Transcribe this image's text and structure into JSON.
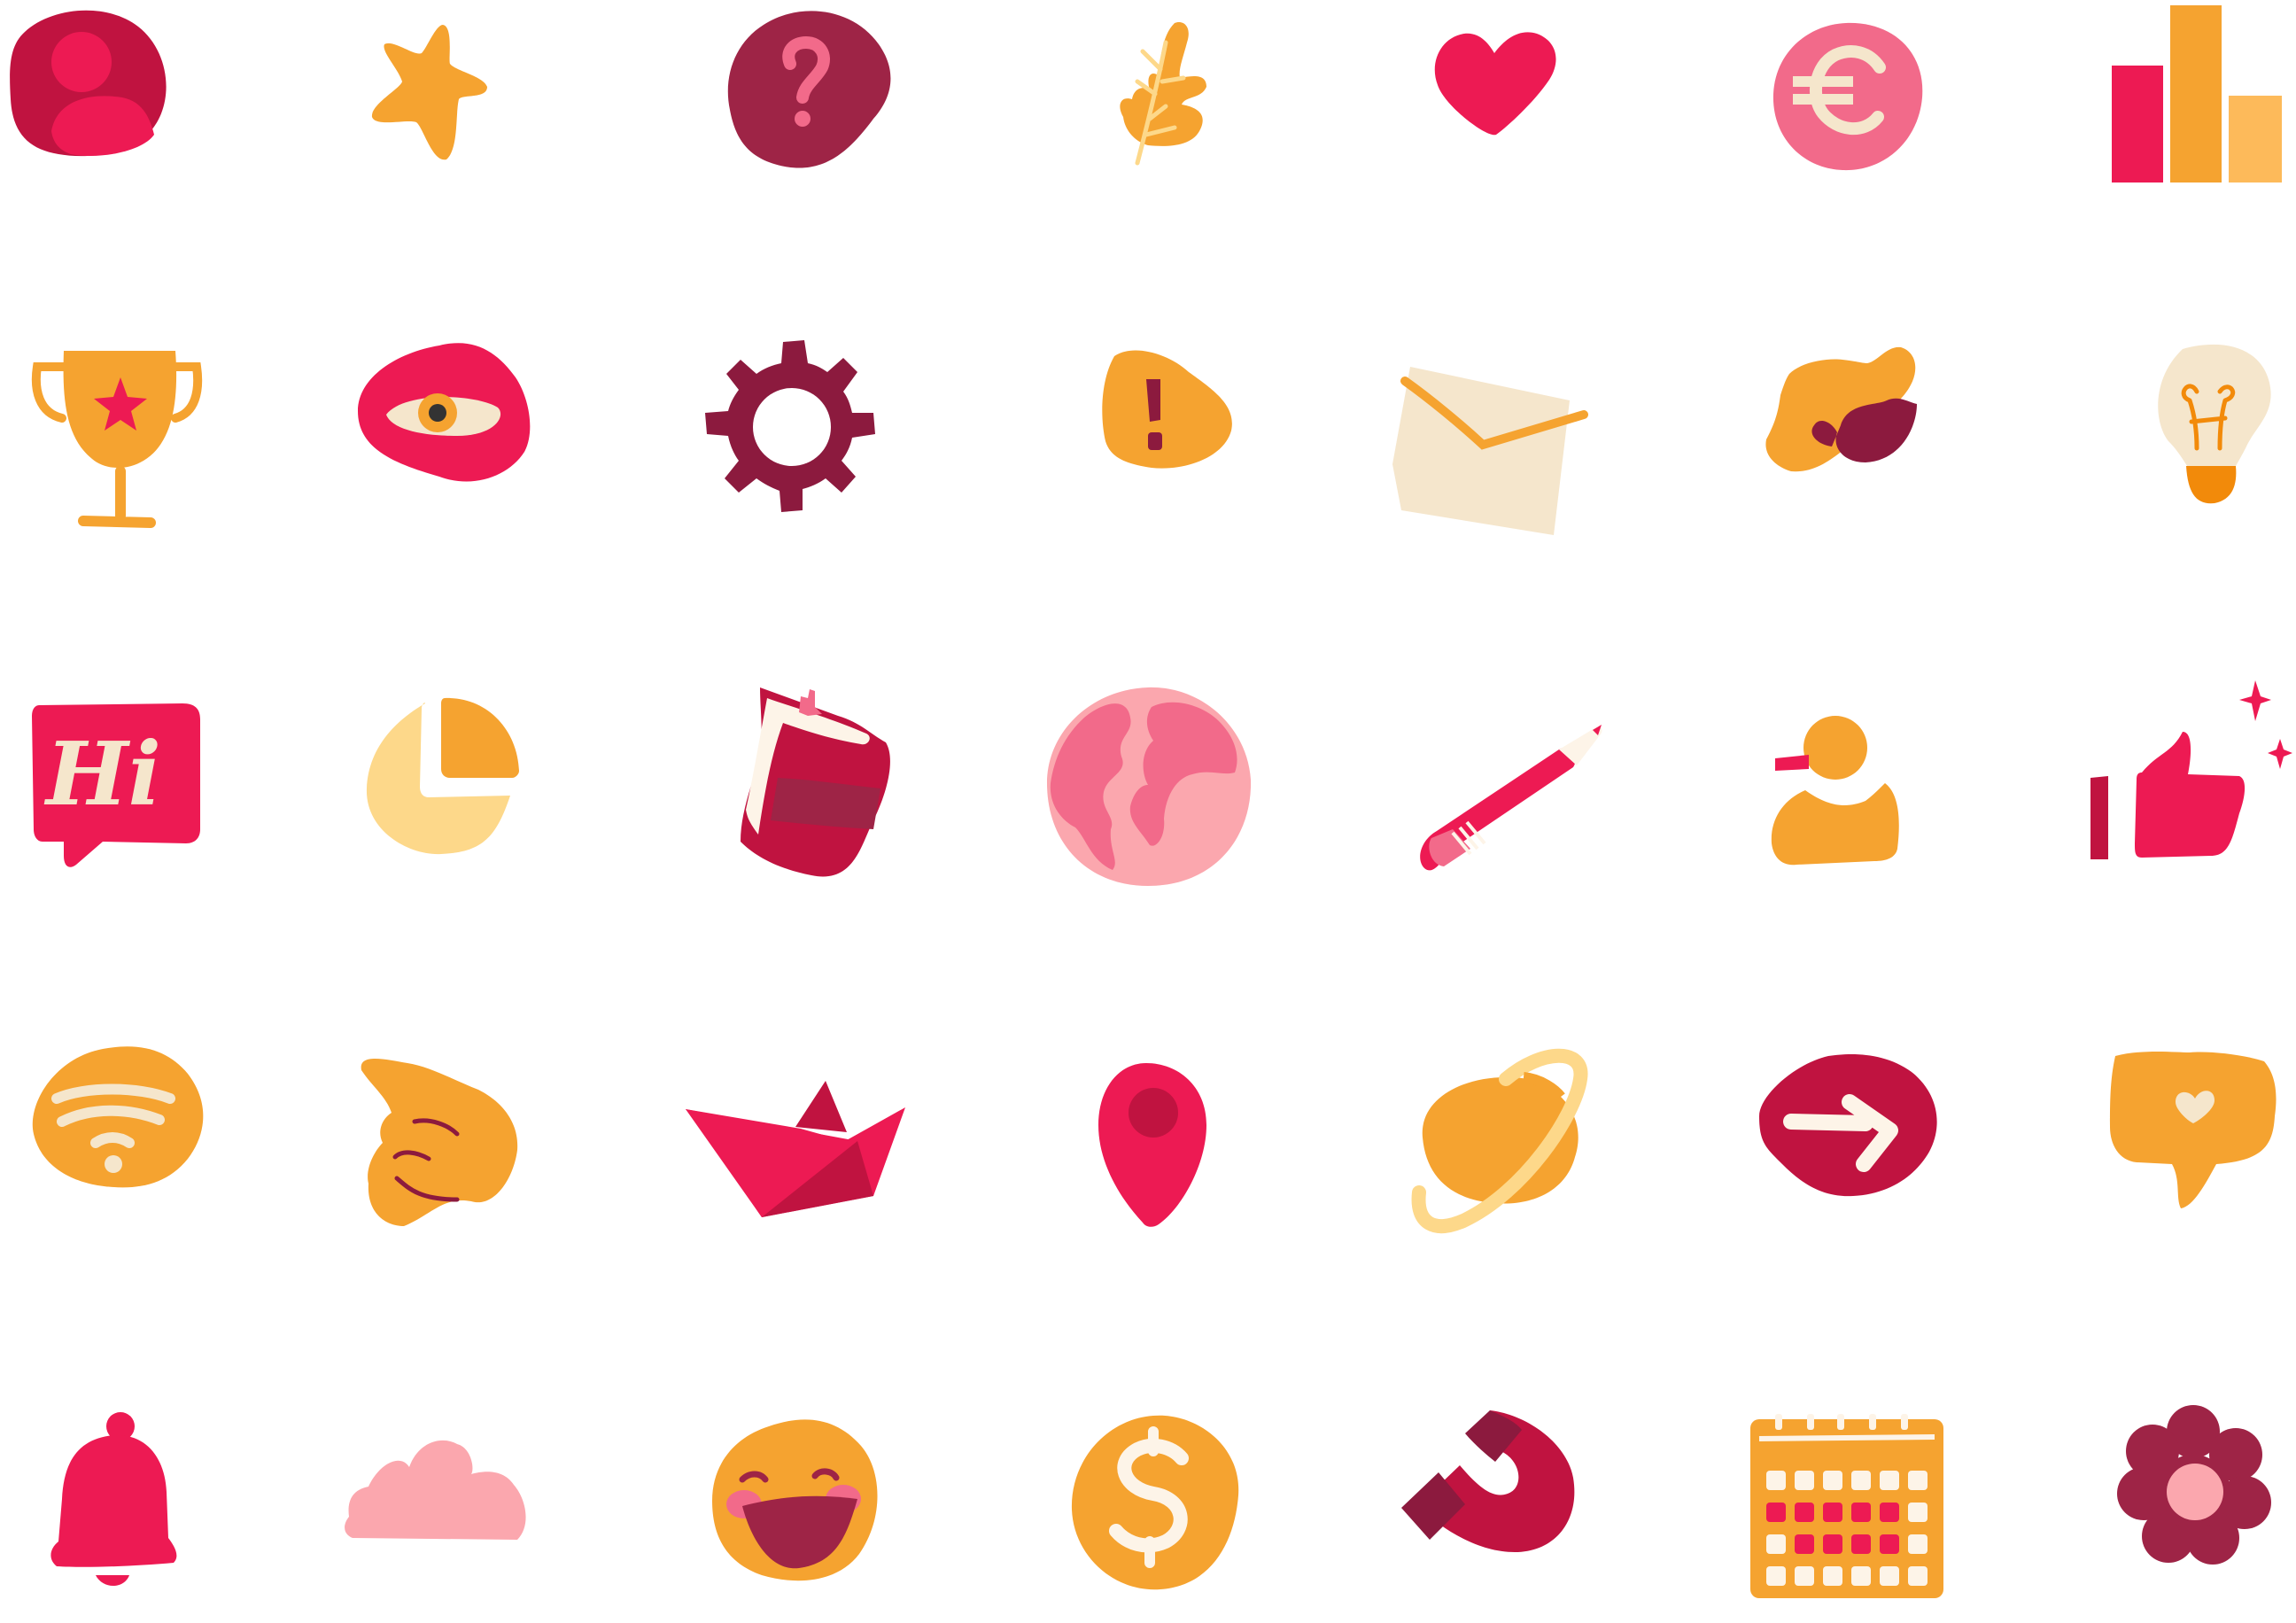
{
  "palette": {
    "crimson": "#C01340",
    "pink": "#ED1A53",
    "wine": "#8C1A3E",
    "maroon": "#9E2446",
    "orange": "#F5A330",
    "light_orange": "#FDBA5A",
    "pale_yellow": "#FDD88A",
    "cream": "#F5E6CC",
    "light_pink": "#FBA7AE",
    "rose": "#F26A8A",
    "dark_orange": "#F28A0A"
  },
  "icons": {
    "speech_bubble_hi_text": "Hi",
    "currency_symbol_euro": "€",
    "currency_symbol_dollar": "$",
    "question_mark": "?",
    "exclamation_mark": "!"
  },
  "icon_names": [
    [
      "user-avatar-icon",
      "star-icon",
      "question-icon",
      "leaf-icon",
      "heart-icon",
      "euro-coin-icon",
      "bar-chart-icon"
    ],
    [
      "trophy-icon",
      "eye-icon",
      "gear-icon",
      "alert-icon",
      "envelope-icon",
      "chat-bubbles-icon",
      "lightbulb-icon"
    ],
    [
      "hi-speech-bubble-icon",
      "pie-chart-icon",
      "book-icon",
      "globe-icon",
      "pencil-icon",
      "rubber-duck-icon",
      "thumbs-up-icon"
    ],
    [
      "wifi-icon",
      "pointing-hand-icon",
      "paper-boat-icon",
      "map-pin-icon",
      "planet-icon",
      "arrow-right-icon",
      "heart-speech-bubble-icon"
    ],
    [
      "bell-icon",
      "cloud-icon",
      "laughing-face-icon",
      "dollar-coin-icon",
      "magnet-icon",
      "calendar-icon",
      "flower-icon"
    ]
  ]
}
